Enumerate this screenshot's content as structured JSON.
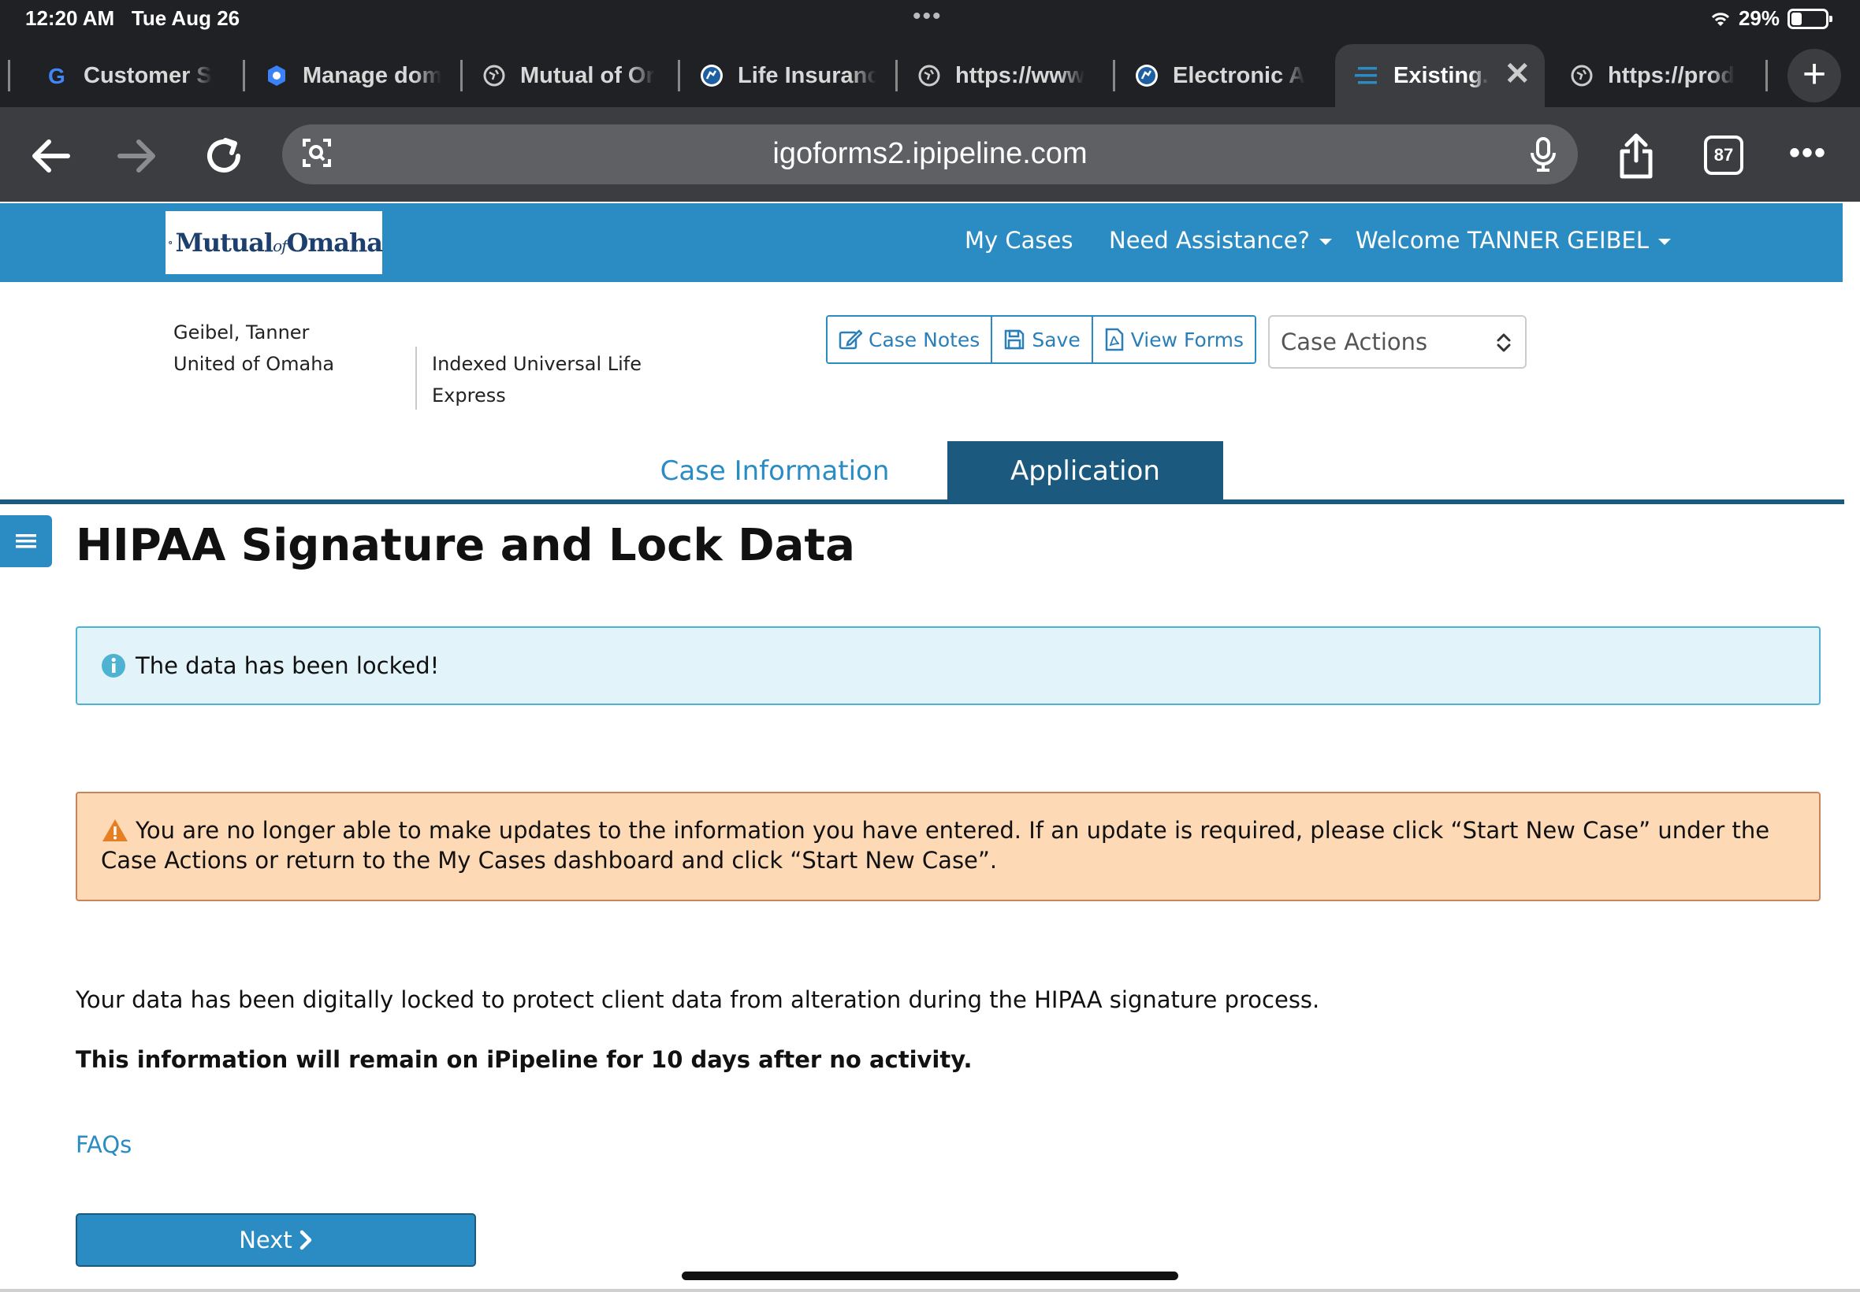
{
  "status_bar": {
    "time": "12:20 AM",
    "date": "Tue Aug 26",
    "battery": "29%"
  },
  "browser": {
    "tabs": [
      {
        "label": "Customer S",
        "icon": "google-icon"
      },
      {
        "label": "Manage dom",
        "icon": "gear-badge-icon"
      },
      {
        "label": "Mutual of Or",
        "icon": "globe-icon"
      },
      {
        "label": "Life Insuranc",
        "icon": "lion-icon"
      },
      {
        "label": "https://www",
        "icon": "globe-icon"
      },
      {
        "label": "Electronic A",
        "icon": "lion-icon"
      },
      {
        "label": "Existing.",
        "icon": "menu-lines-icon",
        "active": true
      },
      {
        "label": "https://prod",
        "icon": "globe-icon"
      }
    ],
    "url": "igoforms2.ipipeline.com",
    "tab_count": "87"
  },
  "site_nav": {
    "logo_text": "MutualOmaha",
    "logo_small": "of",
    "my_cases": "My Cases",
    "need_assistance": "Need Assistance?",
    "welcome_prefix": "Welcome ",
    "welcome_name": "TANNER GEIBEL"
  },
  "case": {
    "client_name": "Geibel, Tanner",
    "company": "United of Omaha",
    "product_line1": "Indexed Universal Life",
    "product_line2": "Express",
    "buttons": {
      "case_notes": "Case Notes",
      "save": "Save",
      "view_forms": "View Forms"
    },
    "case_actions": "Case Actions"
  },
  "main_tabs": {
    "case_information": "Case Information",
    "application": "Application"
  },
  "page_title": "HIPAA Signature and Lock Data",
  "alerts": {
    "info": "The data has been locked!",
    "warning": "You are no longer able to make updates to the information you have entered. If an update is required, please click “Start New Case” under the Case Actions or return to the My Cases dashboard and click “Start New Case”."
  },
  "body": {
    "locked_text": "Your data has been digitally locked to protect client data from alteration during the HIPAA signature process.",
    "retention_text": "This information will remain on iPipeline for 10 days after no activity."
  },
  "faqs": "FAQs",
  "next": "Next",
  "colors": {
    "brand_blue": "#2b8cc4",
    "dark_blue": "#1b5a7e",
    "info_bg": "#e2f3f9",
    "warn_bg": "#fdd9b5"
  }
}
